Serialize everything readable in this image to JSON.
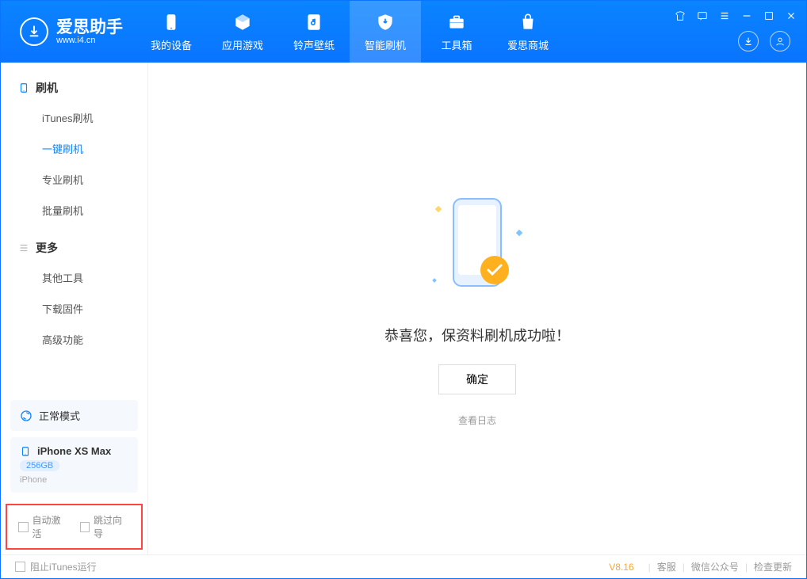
{
  "app": {
    "name": "爱思助手",
    "domain": "www.i4.cn"
  },
  "tabs": {
    "device": "我的设备",
    "apps": "应用游戏",
    "ring": "铃声壁纸",
    "flash": "智能刷机",
    "tools": "工具箱",
    "store": "爱思商城"
  },
  "sidebar": {
    "group_flash": "刷机",
    "itunes_flash": "iTunes刷机",
    "one_click": "一键刷机",
    "pro_flash": "专业刷机",
    "batch_flash": "批量刷机",
    "group_more": "更多",
    "other_tools": "其他工具",
    "download_fw": "下载固件",
    "advanced": "高级功能"
  },
  "device": {
    "mode": "正常模式",
    "name": "iPhone XS Max",
    "capacity": "256GB",
    "type": "iPhone"
  },
  "options": {
    "auto_activate": "自动激活",
    "skip_guide": "跳过向导"
  },
  "main": {
    "success": "恭喜您，保资料刷机成功啦！",
    "ok": "确定",
    "view_log": "查看日志"
  },
  "footer": {
    "block_itunes": "阻止iTunes运行",
    "version": "V8.16",
    "support": "客服",
    "wechat": "微信公众号",
    "update": "检查更新"
  }
}
